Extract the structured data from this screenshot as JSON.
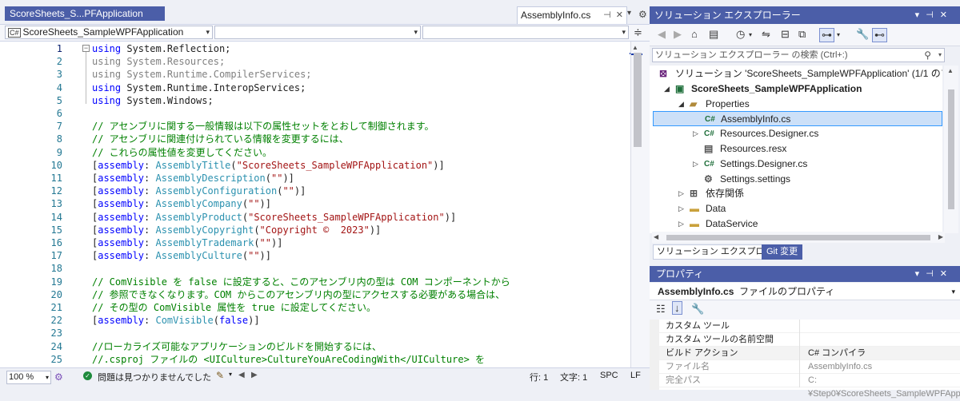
{
  "editor": {
    "tab_left_label": "ScoreSheets_S...PFApplication",
    "tab_active_label": "AssemblyInfo.cs",
    "nav_project": "ScoreSheets_SampleWPFApplication",
    "nav_type": "",
    "nav_member": "",
    "lines": [
      {
        "n": "1",
        "html": "<span class='kw'>using</span> System.Reflection;"
      },
      {
        "n": "2",
        "html": "<span class='gray'>using System.Resources;</span>"
      },
      {
        "n": "3",
        "html": "<span class='gray'>using System.Runtime.CompilerServices;</span>"
      },
      {
        "n": "4",
        "html": "<span class='kw'>using</span> System.Runtime.InteropServices;"
      },
      {
        "n": "5",
        "html": "<span class='kw'>using</span> System.Windows;"
      },
      {
        "n": "6",
        "html": ""
      },
      {
        "n": "7",
        "html": "<span class='cm'>// アセンブリに関する一般情報は以下の属性セットをとおして制御されます。</span>"
      },
      {
        "n": "8",
        "html": "<span class='cm'>// アセンブリに関連付けられている情報を変更するには、</span>"
      },
      {
        "n": "9",
        "html": "<span class='cm'>// これらの属性値を変更してください。</span>"
      },
      {
        "n": "10",
        "html": "[<span class='kw'>assembly</span>: <span class='ty'>AssemblyTitle</span>(<span class='st'>\"ScoreSheets_SampleWPFApplication\"</span>)]"
      },
      {
        "n": "11",
        "html": "[<span class='kw'>assembly</span>: <span class='ty'>AssemblyDescription</span>(<span class='st'>\"\"</span>)]"
      },
      {
        "n": "12",
        "html": "[<span class='kw'>assembly</span>: <span class='ty'>AssemblyConfiguration</span>(<span class='st'>\"\"</span>)]"
      },
      {
        "n": "13",
        "html": "[<span class='kw'>assembly</span>: <span class='ty'>AssemblyCompany</span>(<span class='st'>\"\"</span>)]"
      },
      {
        "n": "14",
        "html": "[<span class='kw'>assembly</span>: <span class='ty'>AssemblyProduct</span>(<span class='st'>\"ScoreSheets_SampleWPFApplication\"</span>)]"
      },
      {
        "n": "15",
        "html": "[<span class='kw'>assembly</span>: <span class='ty'>AssemblyCopyright</span>(<span class='st'>\"Copyright ©  2023\"</span>)]"
      },
      {
        "n": "16",
        "html": "[<span class='kw'>assembly</span>: <span class='ty'>AssemblyTrademark</span>(<span class='st'>\"\"</span>)]"
      },
      {
        "n": "17",
        "html": "[<span class='kw'>assembly</span>: <span class='ty'>AssemblyCulture</span>(<span class='st'>\"\"</span>)]"
      },
      {
        "n": "18",
        "html": ""
      },
      {
        "n": "19",
        "html": "<span class='cm'>// ComVisible を false に設定すると、このアセンブリ内の型は COM コンポーネントから</span>"
      },
      {
        "n": "20",
        "html": "<span class='cm'>// 参照できなくなります。COM からこのアセンブリ内の型にアクセスする必要がある場合は、</span>"
      },
      {
        "n": "21",
        "html": "<span class='cm'>// その型の ComVisible 属性を true に設定してください。</span>"
      },
      {
        "n": "22",
        "html": "[<span class='kw'>assembly</span>: <span class='ty'>ComVisible</span>(<span class='kw'>false</span>)]"
      },
      {
        "n": "23",
        "html": ""
      },
      {
        "n": "24",
        "html": "<span class='cm'>//ローカライズ可能なアプリケーションのビルドを開始するには、</span>"
      },
      {
        "n": "25",
        "html": "<span class='cm'>//.csproj ファイルの &lt;UICulture&gt;CultureYouAreCodingWith&lt;/UICulture&gt; を</span>"
      }
    ]
  },
  "status": {
    "zoom": "100 %",
    "issues": "問題は見つかりませんでした",
    "line": "行: 1",
    "col": "文字: 1",
    "spc": "SPC",
    "lf": "LF"
  },
  "solution_explorer": {
    "title": "ソリューション エクスプローラー",
    "search_placeholder": "ソリューション エクスプローラー の検索 (Ctrl+:)",
    "tab_se": "ソリューション エクスプローラー",
    "tab_git": "Git 変更",
    "items": [
      {
        "label": "ソリューション 'ScoreSheets_SampleWPFApplication' (1/1 のプロジェク",
        "icon": "solution-icon"
      },
      {
        "label": "ScoreSheets_SampleWPFApplication",
        "icon": "csharp-project-icon"
      },
      {
        "label": "Properties",
        "icon": "properties-folder-icon"
      },
      {
        "label": "AssemblyInfo.cs",
        "icon": "csharp-file-icon"
      },
      {
        "label": "Resources.Designer.cs",
        "icon": "csharp-file-icon"
      },
      {
        "label": "Resources.resx",
        "icon": "resx-file-icon"
      },
      {
        "label": "Settings.Designer.cs",
        "icon": "csharp-file-icon"
      },
      {
        "label": "Settings.settings",
        "icon": "settings-file-icon"
      },
      {
        "label": "依存関係",
        "icon": "dependencies-icon"
      },
      {
        "label": "Data",
        "icon": "folder-icon"
      },
      {
        "label": "DataService",
        "icon": "folder-icon"
      }
    ]
  },
  "properties": {
    "title": "プロパティ",
    "object_name": "AssemblyInfo.cs",
    "object_type": "ファイルのプロパティ",
    "rows": [
      {
        "name": "カスタム ツール",
        "value": ""
      },
      {
        "name": "カスタム ツールの名前空間",
        "value": ""
      },
      {
        "name": "ビルド アクション",
        "value": "C# コンパイラ"
      },
      {
        "name": "ファイル名",
        "value": "AssemblyInfo.cs"
      },
      {
        "name": "完全パス",
        "value": "C:¥Step0¥ScoreSheets_SampleWPFApp"
      }
    ]
  },
  "icons": {
    "pin": "pin-icon",
    "close": "close-icon",
    "gear": "gear-icon",
    "search": "search-icon",
    "wrench": "wrench-icon"
  },
  "colors": {
    "accent": "#4b5ea8",
    "keyword": "#0000ff",
    "comment": "#008000",
    "type": "#2b91af",
    "string": "#a31515"
  }
}
